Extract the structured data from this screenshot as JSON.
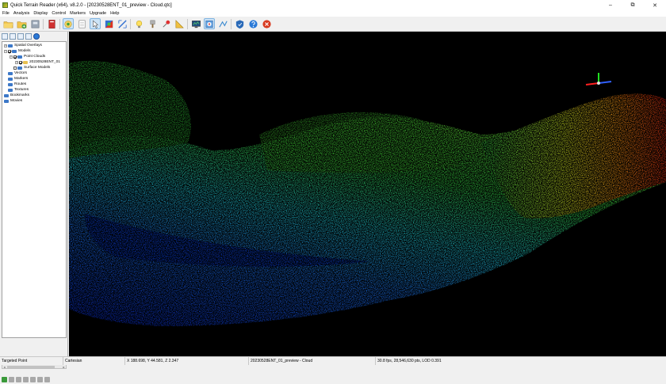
{
  "window": {
    "title": "Quick Terrain Reader (x64), v8.2.0 - [20230528ENT_01_preview - Cloud.qtc]",
    "minimize_glyph": "–",
    "maximize_glyph": "⧉",
    "close_glyph": "✕"
  },
  "menu": {
    "items": [
      "File",
      "Analysis",
      "Display",
      "Control",
      "Markers",
      "Upgrade",
      "Help"
    ]
  },
  "toolbar": {
    "buttons": [
      "open-folder-icon",
      "add-folder-icon",
      "file-icon",
      "book-icon",
      "hand-icon",
      "page-icon",
      "pointer-icon",
      "palette-icon",
      "measure-icon",
      "lightbulb-icon",
      "brush-icon",
      "pin-icon",
      "ruler-icon",
      "monitor-icon",
      "compass-icon",
      "path-icon",
      "shield-icon",
      "help-icon",
      "stop-icon"
    ]
  },
  "tree": {
    "items": [
      {
        "label": "Spatial Overlays",
        "level": 0,
        "expander": "+",
        "checked": false,
        "folder": "blue"
      },
      {
        "label": "Models",
        "level": 0,
        "expander": "−",
        "checked": true,
        "folder": "blue"
      },
      {
        "label": "Point Clouds",
        "level": 1,
        "expander": "−",
        "checked": true,
        "folder": "blue"
      },
      {
        "label": "20230528ENT_01",
        "level": 2,
        "expander": "+",
        "checked": true,
        "folder": "yellow"
      },
      {
        "label": "Surface Models",
        "level": 1,
        "expander": "",
        "checked": false,
        "folder": "blue"
      },
      {
        "label": "Vectors",
        "level": 0,
        "expander": "",
        "checked": false,
        "folder": "blue"
      },
      {
        "label": "Markers",
        "level": 0,
        "expander": "",
        "checked": false,
        "folder": "blue"
      },
      {
        "label": "Routes",
        "level": 0,
        "expander": "",
        "checked": false,
        "folder": "blue"
      },
      {
        "label": "Textures",
        "level": 0,
        "expander": "",
        "checked": false,
        "folder": "blue"
      },
      {
        "label": "Bookmarks",
        "level": 0,
        "expander": "",
        "checked": false,
        "folder": "blue"
      },
      {
        "label": "Movies",
        "level": 0,
        "expander": "",
        "checked": false,
        "folder": "blue"
      }
    ]
  },
  "status": {
    "mode": "Targeted Point",
    "coord_system": "Cartesian",
    "coords": "X 188.698, Y 44.581, Z 2.347",
    "dataset": "20230528ENT_01_preview - Cloud",
    "stats": "30.8 fps, 28,546,630 pts, LOD 0.391"
  },
  "colors": {
    "viewport_bg": "#000000",
    "elevation_low": "#1030d0",
    "elevation_mid": "#30d040",
    "elevation_high": "#e02010",
    "gizmo_x": "#ff2020",
    "gizmo_y": "#20e020",
    "gizmo_z": "#3060ff"
  }
}
